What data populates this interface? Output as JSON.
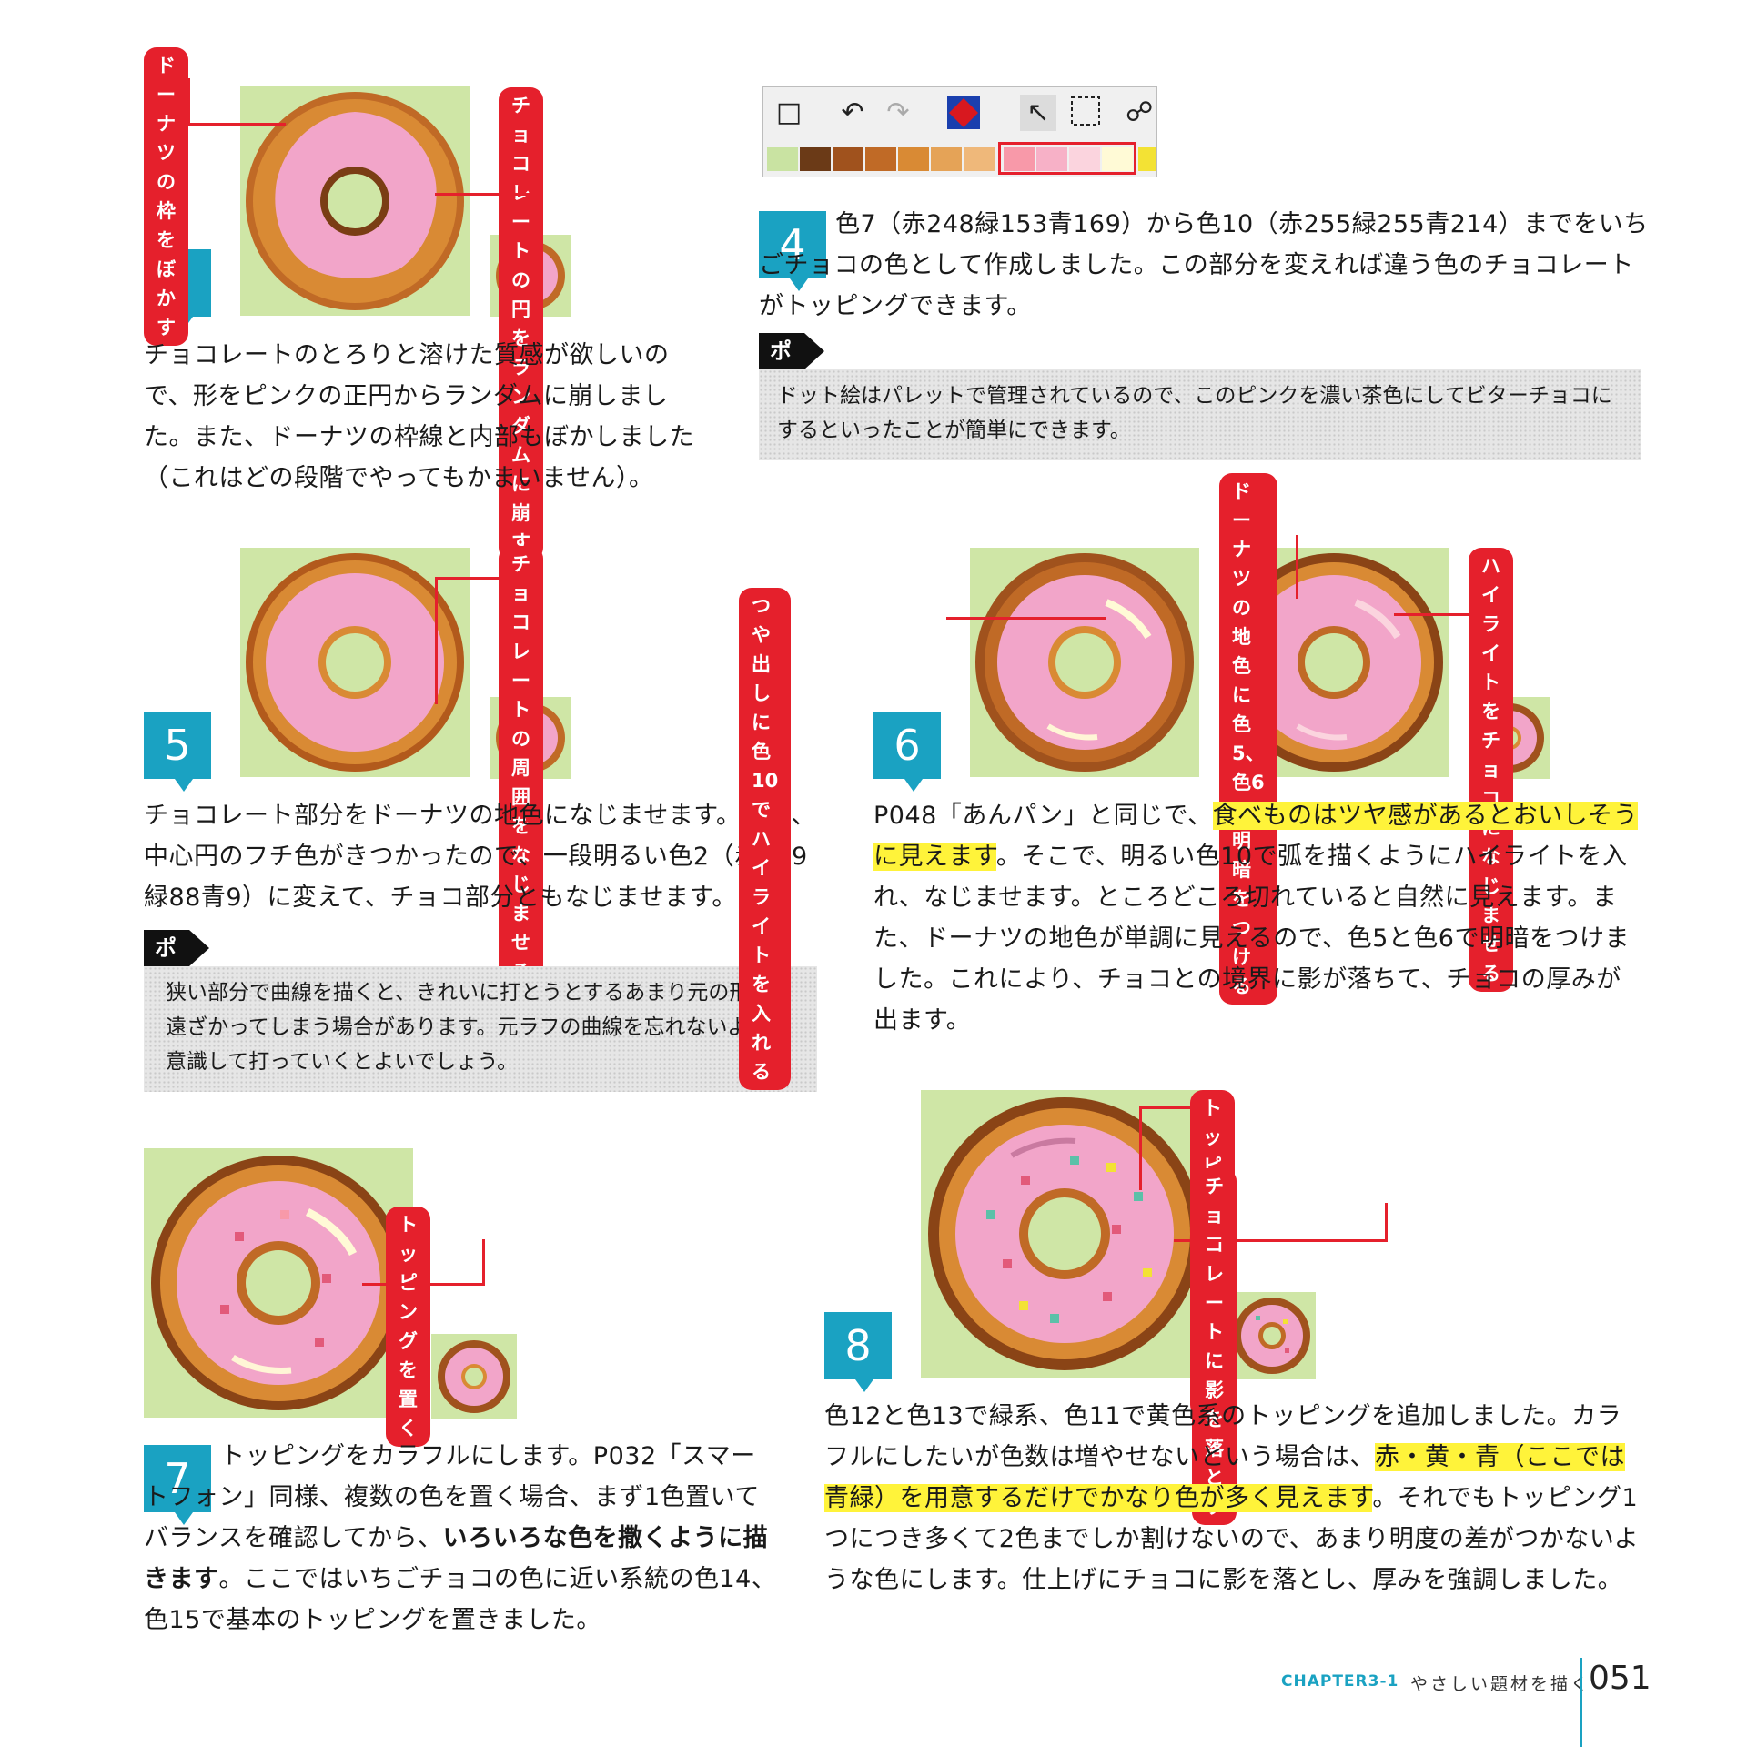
{
  "steps": {
    "s3": {
      "num": "3",
      "callout_a": "ドーナツの枠をぼかす",
      "callout_b": "チョコレートの円を\nランダムに崩す",
      "text": "チョコレートのとろりと溶けた質感が欲しいので、形をピンクの正円からランダムに崩しました。また、ドーナツの枠線と内部もぼかしました（これはどの段階でやってもかまいません）。"
    },
    "s4": {
      "num": "4",
      "text": "色7（赤248緑153青169）から色10（赤255緑255青214）までをいちごチョコの色として作成しました。この部分を変えれば違う色のチョコレートがトッピングできます。",
      "point_label": "ポイント",
      "point_text": "ドット絵はパレットで管理されているので、このピンクを濃い茶色にしてビターチョコにするといったことが簡単にできます。",
      "toolbar_icons": [
        "new-page-icon",
        "undo-icon",
        "redo-icon",
        "palette-icon",
        "cursor-icon",
        "marquee-icon",
        "lock-icon"
      ],
      "palette": [
        "#c9e3a2",
        "#6b3a17",
        "#a0521d",
        "#c06a26",
        "#d98a34",
        "#e5a357",
        "#efb87a",
        "#f899a9",
        "#f7b1c7",
        "#fbd4de",
        "#fffad6",
        "#f3e234"
      ]
    },
    "s5": {
      "num": "5",
      "callout": "チョコレートの\n周囲をなじませる",
      "text": "チョコレート部分をドーナツの地色になじませます。また、中心円のフチ色がきつかったので、一段明るい色2（赤179緑88青9）に変えて、チョコ部分ともなじませます。",
      "point_label": "ポイント",
      "point_text": "狭い部分で曲線を描くと、きれいに打とうとするあまり元の形から遠ざかってしまう場合があります。元ラフの曲線を忘れないように意識して打っていくとよいでしょう。"
    },
    "s6": {
      "num": "6",
      "callout_a": "つや出しに色10で\nハイライトを入れる",
      "callout_b": "ドーナツの地色に色5、\n色6で明暗をつける",
      "callout_c": "ハイライトを\nチョコになじ\nませる",
      "text_before": "P048「あんパン」と同じで、",
      "text_highlight": "食べものはツヤ感があるとおいしそうに見えます",
      "text_after": "。そこで、明るい色10で弧を描くようにハイライトを入れ、なじませます。ところどころ切れていると自然に見えます。また、ドーナツの地色が単調に見えるので、色5と色6で明暗をつけました。これにより、チョコとの境界に影が落ちて、チョコの厚みが出ます。"
    },
    "s7": {
      "num": "7",
      "callout": "トッピングを置く",
      "text_before": "トッピングをカラフルにします。P032「スマートフォン」同様、複数の色を置く場合、まず1色置いてバランスを確認してから、",
      "text_bold": "いろいろな色を撒くように描きます",
      "text_after": "。ここではいちごチョコの色に近い系統の色14、色15で基本のトッピングを置きました。"
    },
    "s8": {
      "num": "8",
      "callout_a": "トッピングをカラフルに",
      "callout_b": "チョコレートに影を落とす",
      "text_before": "色12と色13で緑系、色11で黄色系のトッピングを追加しました。カラフルにしたいが色数は増やせないという場合は、",
      "text_highlight": "赤・黄・青（ここでは青緑）を用意するだけでかなり色が多く見えます",
      "text_after": "。それでもトッピング1つにつき多くて2色までしか割けないので、あまり明度の差がつかないような色にします。仕上げにチョコに影を落とし、厚みを強調しました。"
    }
  },
  "footer": {
    "chapter": "CHAPTER3-1",
    "title": "やさしい題材を描く",
    "page": "051"
  },
  "colors": {
    "accent_red": "#e5202c",
    "accent_blue": "#1aa2c2",
    "highlight": "#fff33a",
    "canvas_green": "#cfe6a6",
    "donut_brown": "#c06a26",
    "chocolate_pink": "#f2a5c9"
  }
}
